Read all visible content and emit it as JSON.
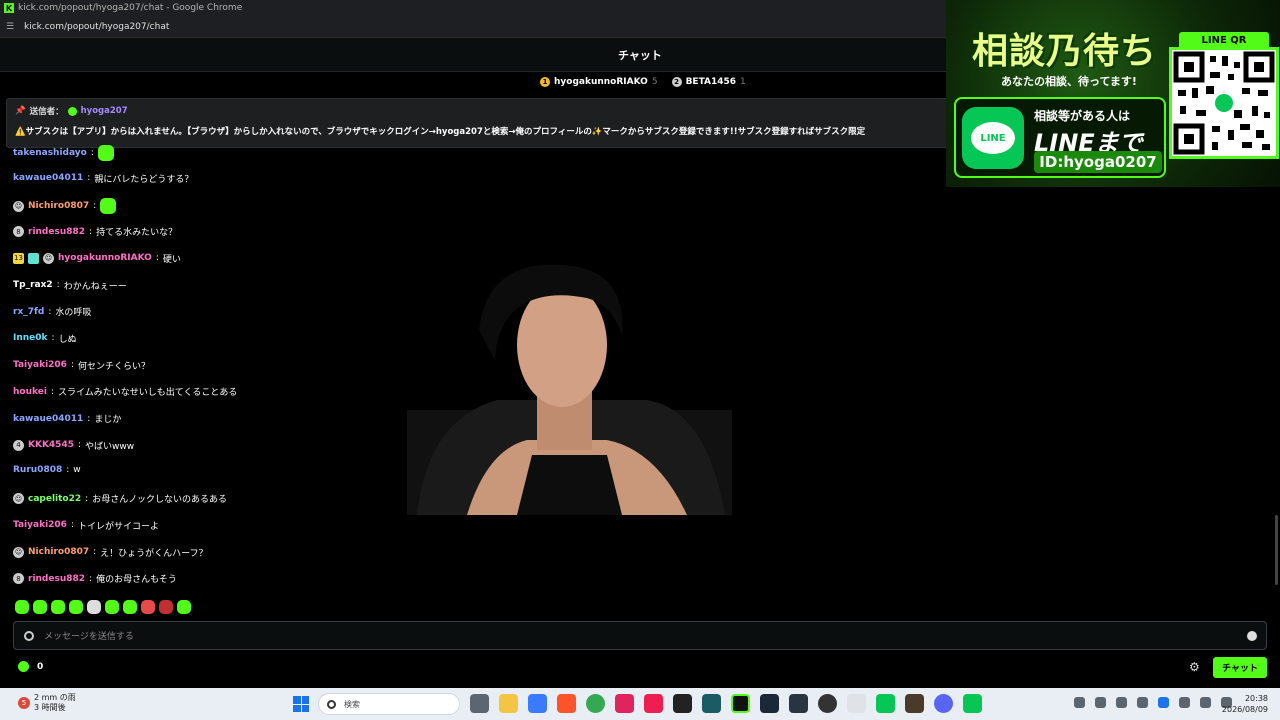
{
  "window": {
    "title": "kick.com/popout/hyoga207/chat - Google Chrome",
    "url": "kick.com/popout/hyoga207/chat"
  },
  "header": {
    "title": "チャット"
  },
  "leaderboard": [
    {
      "rank": "1",
      "name": "hyogakunnoRIAKO",
      "count": "5",
      "color": "#f5b72b"
    },
    {
      "rank": "2",
      "name": "BETA1456",
      "count": "1",
      "color": "#cfcfcf"
    }
  ],
  "pinned": {
    "label": "送信者：",
    "user": "hyoga207",
    "text": "⚠️サブスクは【アプリ】からは入れません。【ブラウザ】からしか入れないので、ブラウザでキックログイン→hyoga207と検索→俺のプロフィールの✨マークからサブスク登録できます!!サブスク登録すればサブスク限定"
  },
  "messages": [
    {
      "user": "takenashidayo",
      "text": "",
      "color": "#8aa7ff",
      "badge": "",
      "emote": true
    },
    {
      "user": "kawaue04011",
      "text": "親にバレたらどうする？",
      "color": "#8aa7ff",
      "badge": ""
    },
    {
      "user": "Nichiro0807",
      "text": "",
      "color": "#ff9d6b",
      "badge": "avatar",
      "emote": true
    },
    {
      "user": "rindesu882",
      "text": "持てる水みたいな？",
      "color": "#ff6ec7",
      "badge": "8"
    },
    {
      "user": "hyogakunnoRIAKO",
      "text": "硬い",
      "color": "#ff6ec7",
      "badge": "13"
    },
    {
      "user": "Tp_rax2",
      "text": "わかんねぇーー",
      "color": "#ffffff",
      "badge": ""
    },
    {
      "user": "rx_7fd",
      "text": "水の呼吸",
      "color": "#8aa7ff",
      "badge": ""
    },
    {
      "user": "Inne0k",
      "text": "しぬ",
      "color": "#5ee0ff",
      "badge": ""
    },
    {
      "user": "Taiyaki206",
      "text": "何センチくらい？",
      "color": "#ff6ec7",
      "badge": ""
    },
    {
      "user": "houkei",
      "text": "スライムみたいなせいしも出てくることある",
      "color": "#ff6ec7",
      "badge": ""
    },
    {
      "user": "kawaue04011",
      "text": "まじか",
      "color": "#8aa7ff",
      "badge": ""
    },
    {
      "user": "KKK4545",
      "text": "やばいwww",
      "color": "#ff6ec7",
      "badge": "4"
    },
    {
      "user": "Ruru0808",
      "text": "w",
      "color": "#8aa7ff",
      "badge": ""
    },
    {
      "user": "capelito22",
      "text": "お母さんノックしないのあるある",
      "color": "#7cff6b",
      "badge": "avatar"
    },
    {
      "user": "Taiyaki206",
      "text": "トイレがサイコーよ",
      "color": "#ff6ec7",
      "badge": ""
    },
    {
      "user": "Nichiro0807",
      "text": "え！ひょうがくんハーフ？",
      "color": "#ff9d6b",
      "badge": "avatar"
    },
    {
      "user": "rindesu882",
      "text": "俺のお母さんもそう",
      "color": "#ff6ec7",
      "badge": "8"
    }
  ],
  "input": {
    "placeholder": "メッセージを送信する"
  },
  "footer": {
    "points": "0",
    "send_label": "チャット"
  },
  "ad": {
    "title": "相談乃待ち",
    "subtitle": "あなたの相談、待ってます!",
    "line1": "相談等がある人は",
    "line2": "LINEまで",
    "line3": "ID:hyoga0207",
    "qr_label": "LINE QR",
    "logo_text": "LINE"
  },
  "taskbar": {
    "weather_line1": "2 mm の雨",
    "weather_line2": "3 時間後",
    "weather_badge": "5",
    "search_placeholder": "検索",
    "time": "20:38",
    "date": "2026/08/09"
  }
}
